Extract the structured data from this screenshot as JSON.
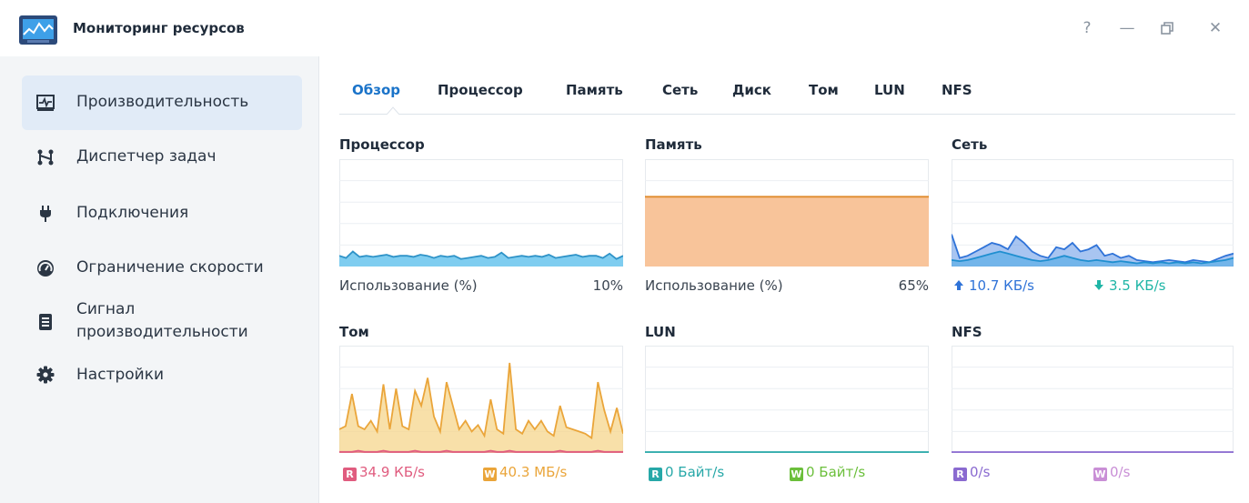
{
  "window": {
    "title": "Мониторинг ресурсов",
    "help_glyph": "?",
    "minimize_glyph": "—",
    "close_glyph": "✕"
  },
  "sidebar": {
    "items": [
      {
        "label": "Производительность",
        "icon": "performance-icon",
        "active": true
      },
      {
        "label": "Диспетчер задач",
        "icon": "task-manager-icon"
      },
      {
        "label": "Подключения",
        "icon": "plug-icon"
      },
      {
        "label": "Ограничение скорости",
        "icon": "speed-gauge-icon"
      },
      {
        "label": "Сигнал производительности",
        "label_line1": "Сигнал",
        "label_line2": "производительности",
        "icon": "document-icon"
      },
      {
        "label": "Настройки",
        "icon": "gear-icon"
      }
    ]
  },
  "tabs": [
    "Обзор",
    "Процессор",
    "Память",
    "Сеть",
    "Диск",
    "Том",
    "LUN",
    "NFS"
  ],
  "active_tab": "Обзор",
  "panels": {
    "cpu": {
      "title": "Процессор",
      "label": "Использование (%)",
      "value": "10%",
      "usage_percent": 10,
      "color": "#46b1e0"
    },
    "memory": {
      "title": "Память",
      "label": "Использование (%)",
      "value": "65%",
      "usage_percent": 65,
      "color": "#f5a561"
    },
    "network": {
      "title": "Сеть",
      "up": "10.7 КБ/s",
      "down": "3.5 КБ/s",
      "up_color": "#2f73d8",
      "down_color": "#1fb5a6"
    },
    "volume": {
      "title": "Том",
      "read_badge": "R",
      "read": "34.9 КБ/s",
      "write_badge": "W",
      "write": "40.3 МБ/s",
      "read_color": "#e05c7f",
      "write_color": "#eaa53a"
    },
    "lun": {
      "title": "LUN",
      "read_badge": "R",
      "read": "0 Байт/s",
      "write_badge": "W",
      "write": "0 Байт/s",
      "read_color": "#27a8a8",
      "write_color": "#6bbf3b"
    },
    "nfs": {
      "title": "NFS",
      "read_badge": "R",
      "read": "0/s",
      "write_badge": "W",
      "write": "0/s",
      "read_color": "#8a6ad0",
      "write_color": "#c98fd6"
    }
  },
  "chart_data": [
    {
      "type": "area",
      "title": "Процессор",
      "ylim": [
        0,
        100
      ],
      "series": [
        {
          "values": [
            10,
            8,
            14,
            9,
            10,
            9,
            10,
            11,
            9,
            10,
            10,
            9,
            11,
            10,
            8,
            10,
            9,
            10,
            7,
            8,
            9,
            10,
            8,
            9,
            13,
            8,
            9,
            10,
            9,
            10,
            9,
            11,
            8,
            9,
            10,
            11,
            9,
            10,
            10,
            8,
            12,
            7,
            10
          ]
        }
      ]
    },
    {
      "type": "area",
      "title": "Память",
      "ylim": [
        0,
        100
      ],
      "series": [
        {
          "values": [
            65,
            65,
            65,
            65,
            65,
            65,
            65,
            65,
            65,
            65
          ]
        }
      ]
    },
    {
      "type": "area",
      "title": "Сеть",
      "ylim": [
        0,
        100
      ],
      "series": [
        {
          "name": "up",
          "values": [
            30,
            8,
            10,
            14,
            18,
            22,
            20,
            16,
            28,
            22,
            14,
            10,
            8,
            18,
            16,
            22,
            14,
            16,
            20,
            10,
            12,
            8,
            10,
            6,
            5,
            4,
            5,
            6,
            5,
            4,
            6,
            5,
            4,
            7,
            10,
            12
          ]
        },
        {
          "name": "down",
          "values": [
            6,
            5,
            6,
            8,
            10,
            12,
            14,
            12,
            10,
            8,
            6,
            5,
            6,
            8,
            10,
            8,
            6,
            5,
            6,
            5,
            4,
            5,
            4,
            3,
            4,
            3,
            4,
            3,
            4,
            3,
            4,
            3,
            4,
            5,
            6,
            8
          ]
        }
      ]
    },
    {
      "type": "area",
      "title": "Том",
      "ylim": [
        0,
        100
      ],
      "series": [
        {
          "name": "write",
          "values": [
            22,
            25,
            55,
            25,
            22,
            30,
            20,
            64,
            22,
            60,
            25,
            22,
            58,
            44,
            70,
            34,
            20,
            66,
            44,
            22,
            30,
            20,
            26,
            16,
            50,
            22,
            18,
            84,
            22,
            18,
            30,
            22,
            30,
            20,
            16,
            44,
            24,
            22,
            20,
            18,
            14,
            66,
            40,
            20,
            42,
            18
          ]
        },
        {
          "name": "read",
          "values": [
            1,
            1,
            1,
            2,
            1,
            1,
            1,
            2,
            1,
            1,
            1,
            1,
            2,
            1,
            1,
            1,
            1,
            2,
            1,
            1,
            1,
            1,
            1,
            1,
            2,
            1,
            1,
            2,
            1,
            1,
            1,
            1,
            1,
            1,
            1,
            2,
            1,
            1,
            1,
            1,
            1,
            2,
            1,
            1,
            1,
            1
          ]
        }
      ]
    },
    {
      "type": "area",
      "title": "LUN",
      "ylim": [
        0,
        100
      ],
      "series": [
        {
          "values": [
            0,
            0,
            0,
            0,
            0,
            0,
            0,
            0,
            0,
            0
          ]
        }
      ]
    },
    {
      "type": "area",
      "title": "NFS",
      "ylim": [
        0,
        100
      ],
      "series": [
        {
          "values": [
            0,
            0,
            0,
            0,
            0,
            0,
            0,
            0,
            0,
            0
          ]
        }
      ]
    }
  ]
}
